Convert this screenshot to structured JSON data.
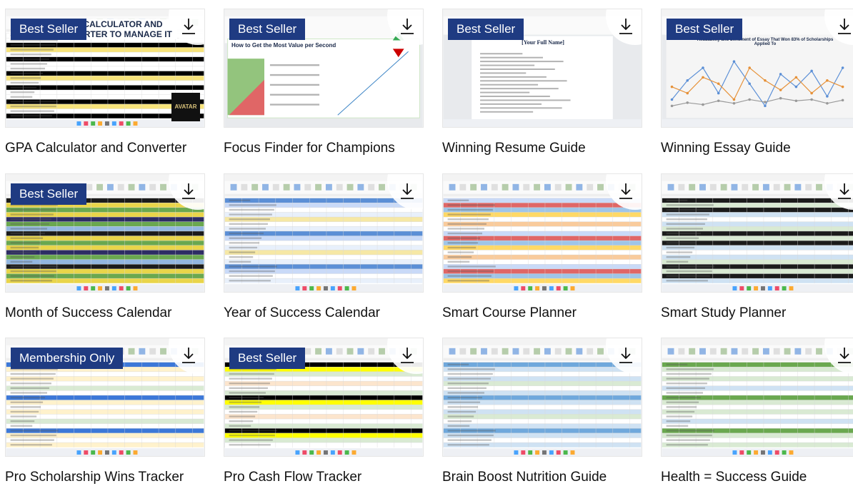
{
  "products": [
    {
      "title": "GPA Calculator and Converter",
      "badge": "Best Seller",
      "thumb_headline": "GPA CALCULATOR AND CONVERTER TO MANAGE IT",
      "thumb_logo": "AVATAR",
      "style": "gpa"
    },
    {
      "title": "Focus Finder for Champions",
      "badge": "Best Seller",
      "thumb_headline": "How to Get the Most Value per Second",
      "style": "focus"
    },
    {
      "title": "Winning Resume Guide",
      "badge": "Best Seller",
      "thumb_headline": "[Your Full Name]",
      "style": "resume"
    },
    {
      "title": "Winning Essay Guide",
      "badge": "Best Seller",
      "thumb_headline": "Readability and Sentiment of Essay That Won 83% of Scholarships Applied To",
      "style": "essay"
    },
    {
      "title": "Month of Success Calendar",
      "badge": "Best Seller",
      "style": "month"
    },
    {
      "title": "Year of Success Calendar",
      "badge": "",
      "style": "year"
    },
    {
      "title": "Smart Course Planner",
      "badge": "",
      "style": "course"
    },
    {
      "title": "Smart Study Planner",
      "badge": "",
      "style": "study"
    },
    {
      "title": "Pro Scholarship Wins Tracker",
      "badge": "Membership Only",
      "style": "scholar"
    },
    {
      "title": "Pro Cash Flow Tracker",
      "badge": "Best Seller",
      "style": "cash"
    },
    {
      "title": "Brain Boost Nutrition Guide",
      "badge": "",
      "style": "brain"
    },
    {
      "title": "Health = Success Guide",
      "badge": "",
      "style": "health"
    }
  ],
  "icons": {
    "download": "download-icon"
  }
}
